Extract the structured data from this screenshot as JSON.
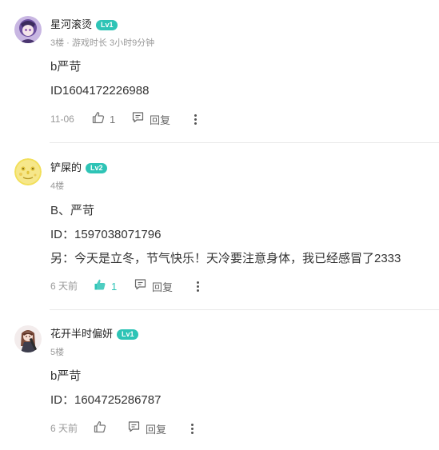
{
  "comments": [
    {
      "username": "星河滚烫",
      "level": "Lv1",
      "meta": "3楼 · 游戏时长 3小时9分钟",
      "lines": [
        "b严苛",
        "ID1604172226988"
      ],
      "date": "11-06",
      "likes": "1",
      "liked": false,
      "reply_label": "回复"
    },
    {
      "username": "铲屎的",
      "level": "Lv2",
      "meta": "4楼",
      "lines": [
        "B、严苛",
        "ID：1597038071796",
        "另：今天是立冬，节气快乐！天冷要注意身体，我已经感冒了2333"
      ],
      "date": "6 天前",
      "likes": "1",
      "liked": true,
      "reply_label": "回复"
    },
    {
      "username": "花开半时偏妍",
      "level": "Lv1",
      "meta": "5楼",
      "lines": [
        "b严苛",
        "ID：1604725286787"
      ],
      "date": "6 天前",
      "likes": "",
      "liked": false,
      "reply_label": "回复"
    }
  ],
  "colors": {
    "accent": "#2ec4b6",
    "muted": "#999999",
    "text": "#333333"
  }
}
